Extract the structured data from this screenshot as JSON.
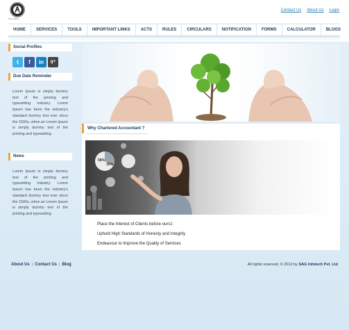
{
  "header": {
    "logo_caption": "ICAI 2012",
    "links": [
      "Contact Us",
      "About Us",
      "Login"
    ]
  },
  "nav": {
    "items": [
      "HOME",
      "SERVICES",
      "TOOLS",
      "IMPORTANT LINKS",
      "ACTS",
      "RULES",
      "CIRCULARS",
      "NOTIFICATION",
      "FORMS",
      "CALCULATOR",
      "BLOGS"
    ]
  },
  "sidebar": {
    "social_title": "Social Profiles",
    "social_icons": [
      "twitter-icon",
      "facebook-icon",
      "linkedin-icon",
      "google-plus-icon"
    ],
    "due_date_title": "Due Date Reminder",
    "due_date_text": "Lorem Ipsum is simply dummy text of the printing and typesetting industry. Lorem Ipsum has been the industry's standard dummy text ever since the 1500s, when an Lorem Ipsum is simply dummy text of the printing and typesetting",
    "news_title": "News",
    "news_text": "Lorem Ipsum is simply dummy text of the printing and typesetting industry. Lorem Ipsum has been the industry's standard dummy text ever since the 1500s, when an Lorem Ipsum is simply dummy text of the printing and typesetting"
  },
  "main": {
    "section_title": "Why Chartered Accountant ?",
    "chart_labels": [
      "58%",
      "35%"
    ],
    "points": [
      "Place the Interest of Clients before ours1",
      "Uphold High Standards of Honesty and Integrity",
      "Endeavour to Improve the Quality of Services"
    ]
  },
  "footer": {
    "links": [
      "About Us",
      "Contact Us",
      "Blog"
    ],
    "copyright": "All rights reserved. © 2012 by",
    "company": "SAG Infotech Pvt. Ltd"
  },
  "colors": {
    "accent": "#f0a43a",
    "link": "#2a7fb5",
    "nav_text": "#1a3a5a",
    "background": "#dcebf6"
  }
}
